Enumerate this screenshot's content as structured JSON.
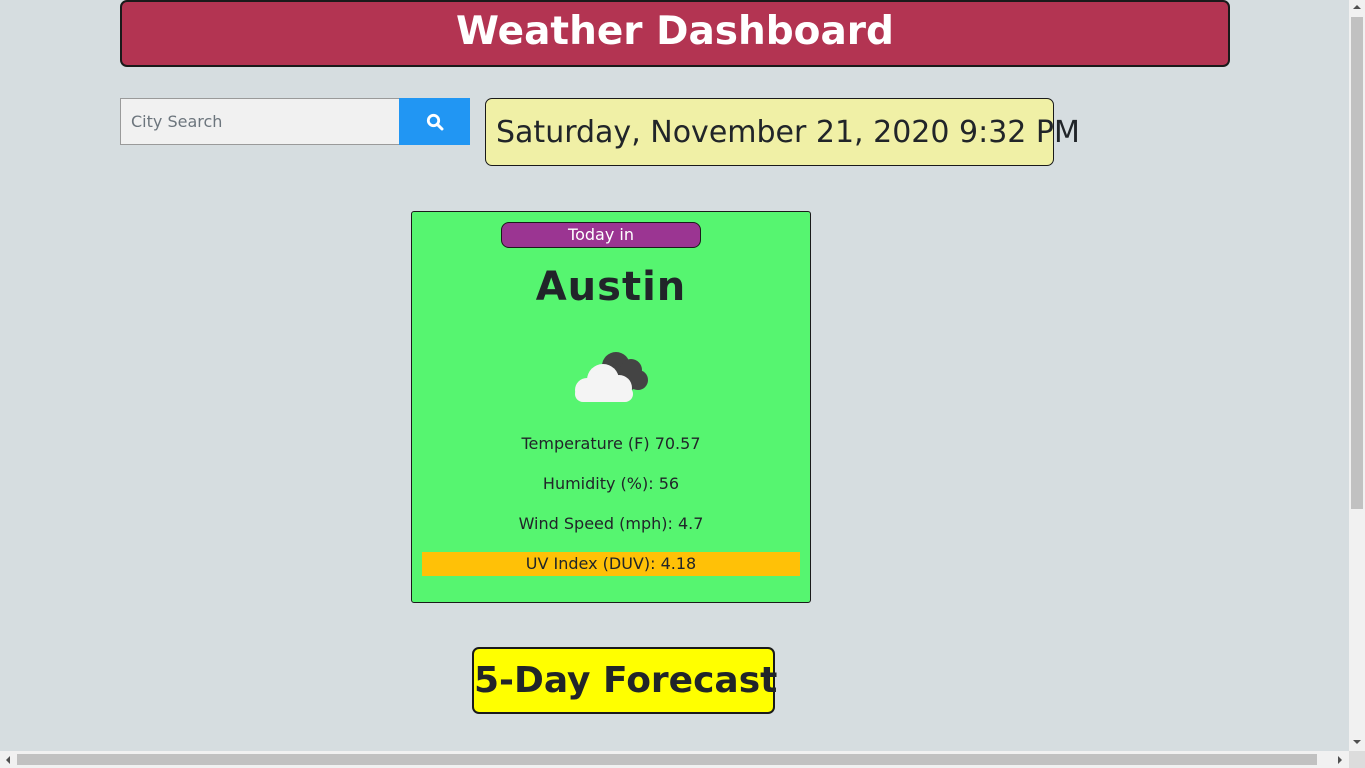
{
  "header": {
    "title": "Weather Dashboard"
  },
  "search": {
    "placeholder": "City Search",
    "value": "",
    "button_icon": "search-icon"
  },
  "datetime": "Saturday, November 21, 2020 9:32 PM",
  "today": {
    "badge": "Today in",
    "city": "Austin",
    "icon": "cloudy-icon",
    "temperature": "Temperature (F) 70.57",
    "humidity": "Humidity (%): 56",
    "wind": "Wind Speed (mph): 4.7",
    "uv": "UV Index (DUV): 4.18"
  },
  "forecast": {
    "title": "5-Day Forecast"
  },
  "colors": {
    "header_bg": "#b33452",
    "search_button": "#2196f3",
    "datetime_bg": "#f0f0a6",
    "today_card_bg": "#56f570",
    "badge_bg": "#9b3592",
    "uv_moderate": "#ffc107",
    "forecast_title_bg": "#ffff00",
    "page_bg": "#d6dde0"
  }
}
